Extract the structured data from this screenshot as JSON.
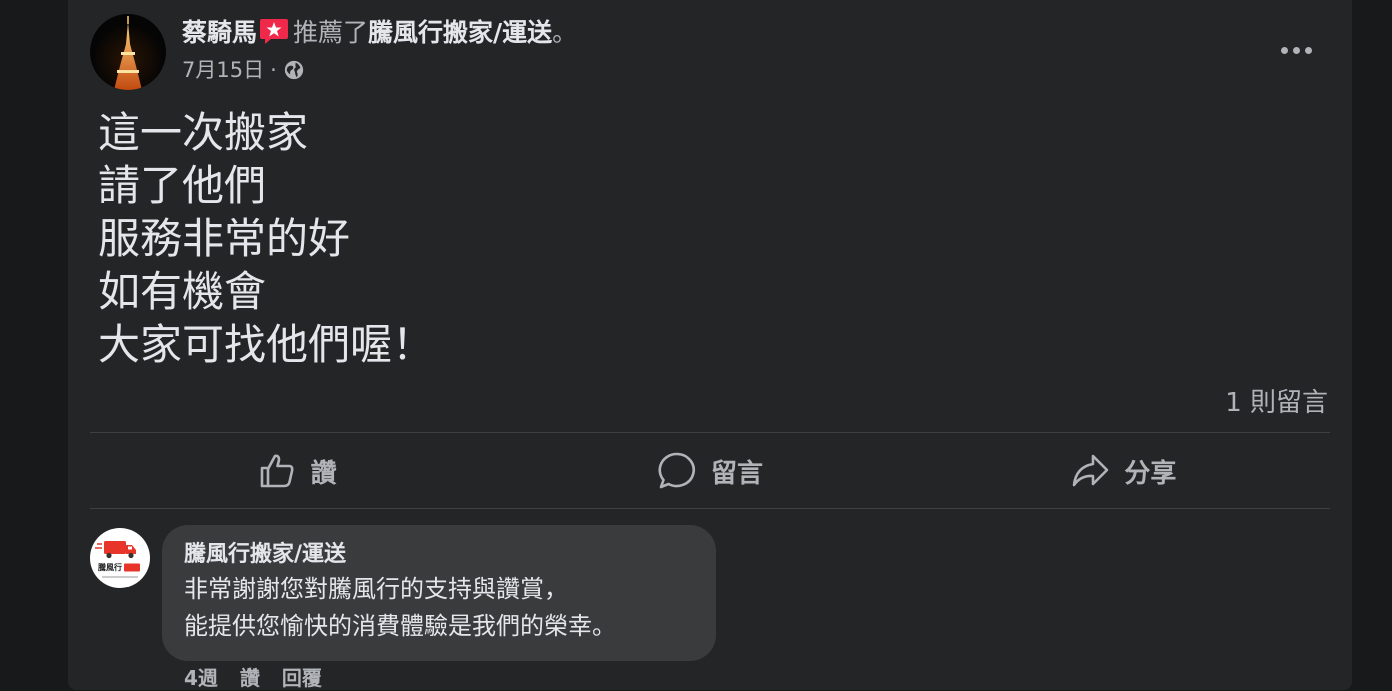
{
  "post": {
    "author_name": "蔡騎馬",
    "verb": "推薦了",
    "page_name": "騰風行搬家/運送",
    "period": "。",
    "date": "7月15日",
    "date_sep": "·",
    "body_lines": [
      "這一次搬家",
      "請了他們",
      "服務非常的好",
      "如有機會",
      "大家可找他們喔！"
    ],
    "comment_count": "1 則留言"
  },
  "actions": {
    "like": "讚",
    "comment": "留言",
    "share": "分享"
  },
  "comment": {
    "author": "騰風行搬家/運送",
    "lines": [
      "非常謝謝您對騰風行的支持與讚賞，",
      "能提供您愉快的消費體驗是我們的榮幸。"
    ],
    "avatar_text": "騰風行"
  },
  "comment_meta": {
    "time": "4週",
    "like": "讚",
    "reply": "回覆"
  },
  "colors": {
    "page_bg": "#18191a",
    "card_bg": "#242526",
    "bubble_bg": "#3a3b3c",
    "text_primary": "#e4e6eb",
    "text_secondary": "#b0b3b8",
    "badge_red": "#f0284a"
  },
  "icons": {
    "badge": "recommend-star-badge-icon",
    "audience": "globe-icon",
    "more": "more-options-icon",
    "like": "thumbs-up-icon",
    "comment": "comment-bubble-icon",
    "share": "share-arrow-icon"
  }
}
